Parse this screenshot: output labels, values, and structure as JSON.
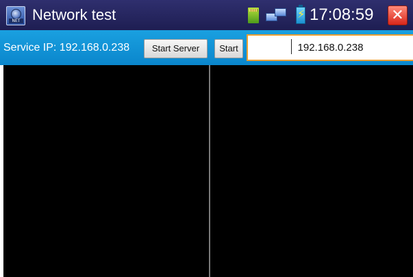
{
  "window": {
    "title": "Network test",
    "app_icon_tag": "NET",
    "clock": "17:08:59",
    "status_icons": [
      "sd-card-icon",
      "network-icon",
      "battery-charging-icon"
    ],
    "close_glyph": "✕"
  },
  "toolbar": {
    "service_ip_text": "Service IP: 192.168.0.238",
    "start_server_label": "Start Server",
    "start_label": "Start",
    "target_ip_value": "192.168.0.238"
  },
  "colors": {
    "titlebar": "#1e1e52",
    "toolbar": "#0a86cc",
    "input_border": "#f0a030",
    "panel": "#000000",
    "close_button": "#d8261a"
  }
}
